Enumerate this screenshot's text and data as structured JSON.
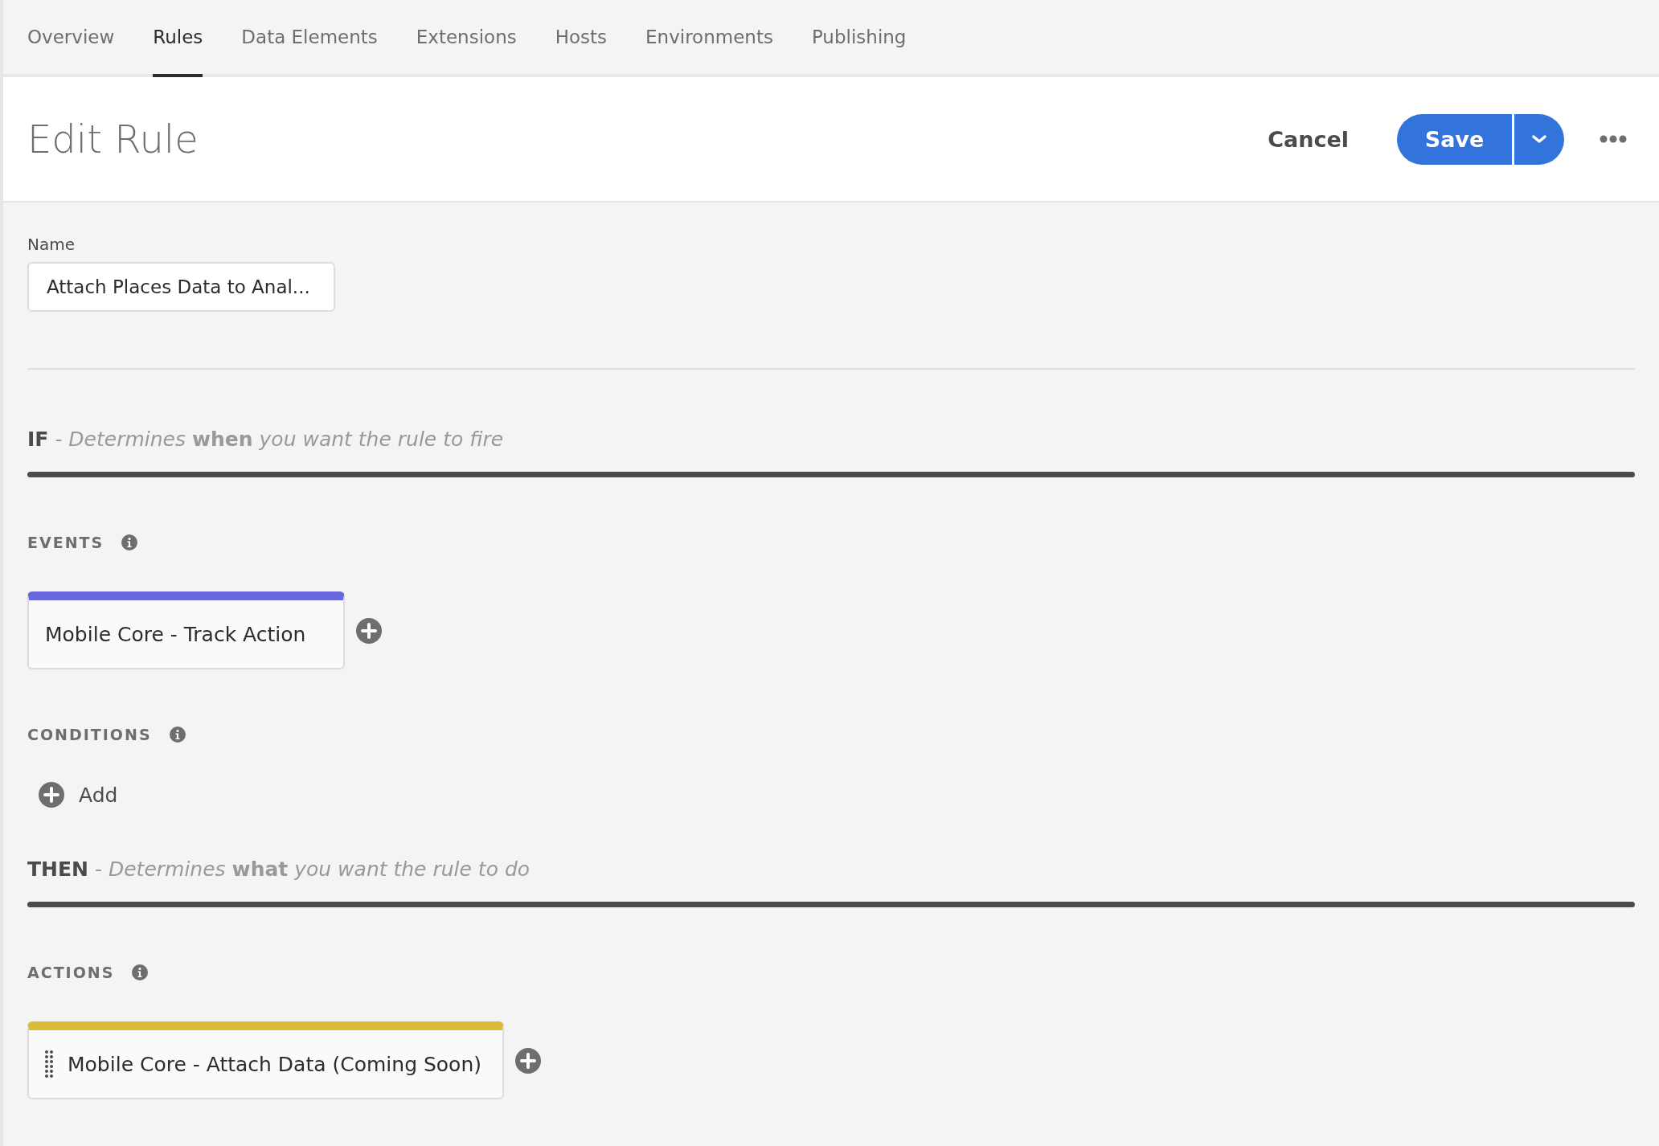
{
  "tabs": [
    {
      "label": "Overview",
      "selected": false
    },
    {
      "label": "Rules",
      "selected": true
    },
    {
      "label": "Data Elements",
      "selected": false
    },
    {
      "label": "Extensions",
      "selected": false
    },
    {
      "label": "Hosts",
      "selected": false
    },
    {
      "label": "Environments",
      "selected": false
    },
    {
      "label": "Publishing",
      "selected": false
    }
  ],
  "header": {
    "title": "Edit Rule",
    "cancel": "Cancel",
    "save": "Save"
  },
  "name_field": {
    "label": "Name",
    "value": "Attach Places Data to Anal..."
  },
  "sections": [
    {
      "keyword": "IF",
      "description": "- *Determines* **when** *you want the rule to fire*",
      "groups": [
        {
          "title": "EVENTS",
          "kind": "cards",
          "cards": [
            {
              "label": "Mobile Core - Track Action",
              "color": "#6767e0",
              "draggable": false
            }
          ]
        },
        {
          "title": "CONDITIONS",
          "kind": "add",
          "add_label": "Add"
        }
      ]
    },
    {
      "keyword": "THEN",
      "description": "- *Determines* **what** *you want the rule to do*",
      "groups": [
        {
          "title": "ACTIONS",
          "kind": "cards",
          "cards": [
            {
              "label": "Mobile Core - Attach Data (Coming Soon)",
              "color": "#d9bd3a",
              "draggable": true
            }
          ]
        }
      ]
    }
  ]
}
